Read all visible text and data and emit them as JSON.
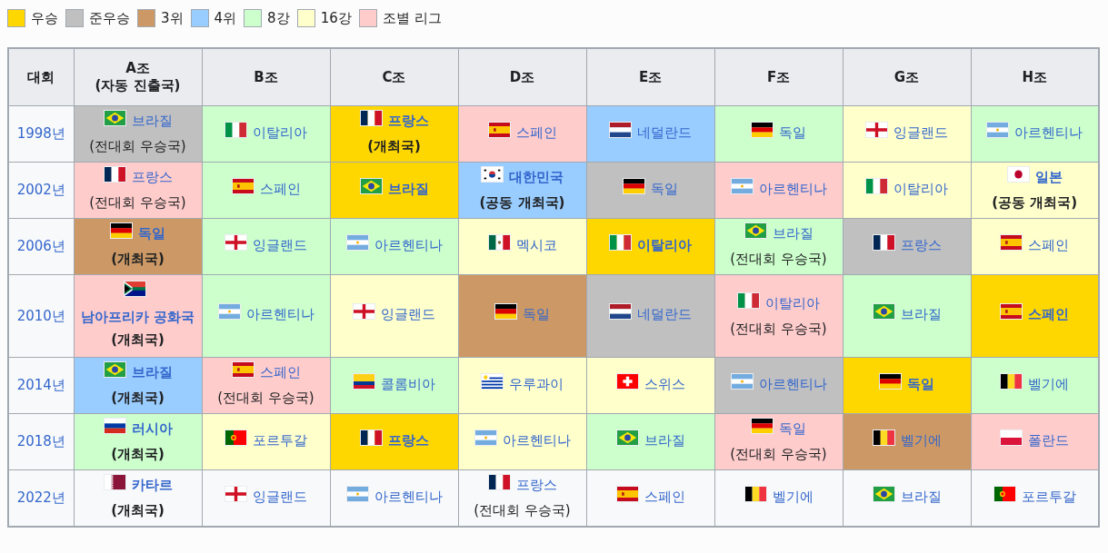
{
  "legend": [
    {
      "label": "우승",
      "color": "#ffd700"
    },
    {
      "label": "준우승",
      "color": "#c0c0c0"
    },
    {
      "label": "3위",
      "color": "#cc9966"
    },
    {
      "label": "4위",
      "color": "#99ccff"
    },
    {
      "label": "8강",
      "color": "#ccffcc"
    },
    {
      "label": "16강",
      "color": "#ffffcc"
    },
    {
      "label": "조별 리그",
      "color": "#ffcccc"
    }
  ],
  "table": {
    "columns": [
      {
        "label": "대회"
      },
      {
        "label": "A조",
        "note": "(자동 진출국)"
      },
      {
        "label": "B조"
      },
      {
        "label": "C조"
      },
      {
        "label": "D조"
      },
      {
        "label": "E조"
      },
      {
        "label": "F조"
      },
      {
        "label": "G조"
      },
      {
        "label": "H조"
      }
    ],
    "rows": [
      {
        "cells": [
          {
            "kind": "year",
            "text": "1998년"
          },
          {
            "kind": "br",
            "country": "브라질",
            "color": "#c0c0c0",
            "bold": false,
            "note": "(전대회 우승국)"
          },
          {
            "kind": "it",
            "country": "이탈리아",
            "color": "#ccffcc",
            "bold": false
          },
          {
            "kind": "fr",
            "country": "프랑스",
            "color": "#ffd700",
            "bold": true,
            "note": "(개최국)"
          },
          {
            "kind": "es",
            "country": "스페인",
            "color": "#ffcccc",
            "bold": false
          },
          {
            "kind": "nl",
            "country": "네덜란드",
            "color": "#99ccff",
            "bold": false
          },
          {
            "kind": "de",
            "country": "독일",
            "color": "#ccffcc",
            "bold": false
          },
          {
            "kind": "en",
            "country": "잉글랜드",
            "color": "#ffffcc",
            "bold": false
          },
          {
            "kind": "ar",
            "country": "아르헨티나",
            "color": "#ccffcc",
            "bold": false
          }
        ]
      },
      {
        "cells": [
          {
            "kind": "year",
            "text": "2002년"
          },
          {
            "kind": "fr",
            "country": "프랑스",
            "color": "#ffcccc",
            "bold": false,
            "note": "(전대회 우승국)"
          },
          {
            "kind": "es",
            "country": "스페인",
            "color": "#ccffcc",
            "bold": false
          },
          {
            "kind": "br",
            "country": "브라질",
            "color": "#ffd700",
            "bold": true
          },
          {
            "kind": "kr",
            "country": "대한민국",
            "color": "#99ccff",
            "bold": true,
            "note": "(공동 개최국)"
          },
          {
            "kind": "de",
            "country": "독일",
            "color": "#c0c0c0",
            "bold": false
          },
          {
            "kind": "ar",
            "country": "아르헨티나",
            "color": "#ffcccc",
            "bold": false
          },
          {
            "kind": "it",
            "country": "이탈리아",
            "color": "#ffffcc",
            "bold": false
          },
          {
            "kind": "jp",
            "country": "일본",
            "color": "#ffffcc",
            "bold": true,
            "note": "(공동 개최국)"
          }
        ]
      },
      {
        "cells": [
          {
            "kind": "year",
            "text": "2006년"
          },
          {
            "kind": "de",
            "country": "독일",
            "color": "#cc9966",
            "bold": true,
            "note": "(개최국)"
          },
          {
            "kind": "en",
            "country": "잉글랜드",
            "color": "#ccffcc",
            "bold": false
          },
          {
            "kind": "ar",
            "country": "아르헨티나",
            "color": "#ccffcc",
            "bold": false
          },
          {
            "kind": "mx",
            "country": "멕시코",
            "color": "#ffffcc",
            "bold": false
          },
          {
            "kind": "it",
            "country": "이탈리아",
            "color": "#ffd700",
            "bold": true
          },
          {
            "kind": "br",
            "country": "브라질",
            "color": "#ccffcc",
            "bold": false,
            "note": "(전대회 우승국)"
          },
          {
            "kind": "fr",
            "country": "프랑스",
            "color": "#c0c0c0",
            "bold": false
          },
          {
            "kind": "es",
            "country": "스페인",
            "color": "#ffffcc",
            "bold": false
          }
        ]
      },
      {
        "cells": [
          {
            "kind": "year",
            "text": "2010년"
          },
          {
            "kind": "za",
            "country": "남아프리카 공화국",
            "color": "#ffcccc",
            "bold": true,
            "note": "(개최국)"
          },
          {
            "kind": "ar",
            "country": "아르헨티나",
            "color": "#ccffcc",
            "bold": false
          },
          {
            "kind": "en",
            "country": "잉글랜드",
            "color": "#ffffcc",
            "bold": false
          },
          {
            "kind": "de",
            "country": "독일",
            "color": "#cc9966",
            "bold": false
          },
          {
            "kind": "nl",
            "country": "네덜란드",
            "color": "#c0c0c0",
            "bold": false
          },
          {
            "kind": "it",
            "country": "이탈리아",
            "color": "#ffcccc",
            "bold": false,
            "note": "(전대회 우승국)"
          },
          {
            "kind": "br",
            "country": "브라질",
            "color": "#ccffcc",
            "bold": false
          },
          {
            "kind": "es",
            "country": "스페인",
            "color": "#ffd700",
            "bold": true
          }
        ]
      },
      {
        "cells": [
          {
            "kind": "year",
            "text": "2014년"
          },
          {
            "kind": "br",
            "country": "브라질",
            "color": "#99ccff",
            "bold": true,
            "note": "(개최국)"
          },
          {
            "kind": "es",
            "country": "스페인",
            "color": "#ffcccc",
            "bold": false,
            "note": "(전대회 우승국)"
          },
          {
            "kind": "co",
            "country": "콜롬비아",
            "color": "#ccffcc",
            "bold": false
          },
          {
            "kind": "uy",
            "country": "우루과이",
            "color": "#ffffcc",
            "bold": false
          },
          {
            "kind": "ch",
            "country": "스위스",
            "color": "#ffffcc",
            "bold": false
          },
          {
            "kind": "ar",
            "country": "아르헨티나",
            "color": "#c0c0c0",
            "bold": false
          },
          {
            "kind": "de",
            "country": "독일",
            "color": "#ffd700",
            "bold": true
          },
          {
            "kind": "be",
            "country": "벨기에",
            "color": "#ccffcc",
            "bold": false
          }
        ]
      },
      {
        "cells": [
          {
            "kind": "year",
            "text": "2018년"
          },
          {
            "kind": "ru",
            "country": "러시아",
            "color": "#ccffcc",
            "bold": true,
            "note": "(개최국)"
          },
          {
            "kind": "pt",
            "country": "포르투갈",
            "color": "#ffffcc",
            "bold": false
          },
          {
            "kind": "fr",
            "country": "프랑스",
            "color": "#ffd700",
            "bold": true
          },
          {
            "kind": "ar",
            "country": "아르헨티나",
            "color": "#ffffcc",
            "bold": false
          },
          {
            "kind": "br",
            "country": "브라질",
            "color": "#ccffcc",
            "bold": false
          },
          {
            "kind": "de",
            "country": "독일",
            "color": "#ffcccc",
            "bold": false,
            "note": "(전대회 우승국)"
          },
          {
            "kind": "be",
            "country": "벨기에",
            "color": "#cc9966",
            "bold": false
          },
          {
            "kind": "pl",
            "country": "폴란드",
            "color": "#ffcccc",
            "bold": false
          }
        ]
      },
      {
        "cells": [
          {
            "kind": "year",
            "text": "2022년"
          },
          {
            "kind": "qa",
            "country": "카타르",
            "bold": true,
            "note": "(개최국)"
          },
          {
            "kind": "en",
            "country": "잉글랜드",
            "bold": false
          },
          {
            "kind": "ar",
            "country": "아르헨티나",
            "bold": false
          },
          {
            "kind": "fr",
            "country": "프랑스",
            "bold": false,
            "note": "(전대회 우승국)"
          },
          {
            "kind": "es",
            "country": "스페인",
            "bold": false
          },
          {
            "kind": "be",
            "country": "벨기에",
            "bold": false
          },
          {
            "kind": "br",
            "country": "브라질",
            "bold": false
          },
          {
            "kind": "pt",
            "country": "포르투갈",
            "bold": false
          }
        ]
      }
    ]
  }
}
